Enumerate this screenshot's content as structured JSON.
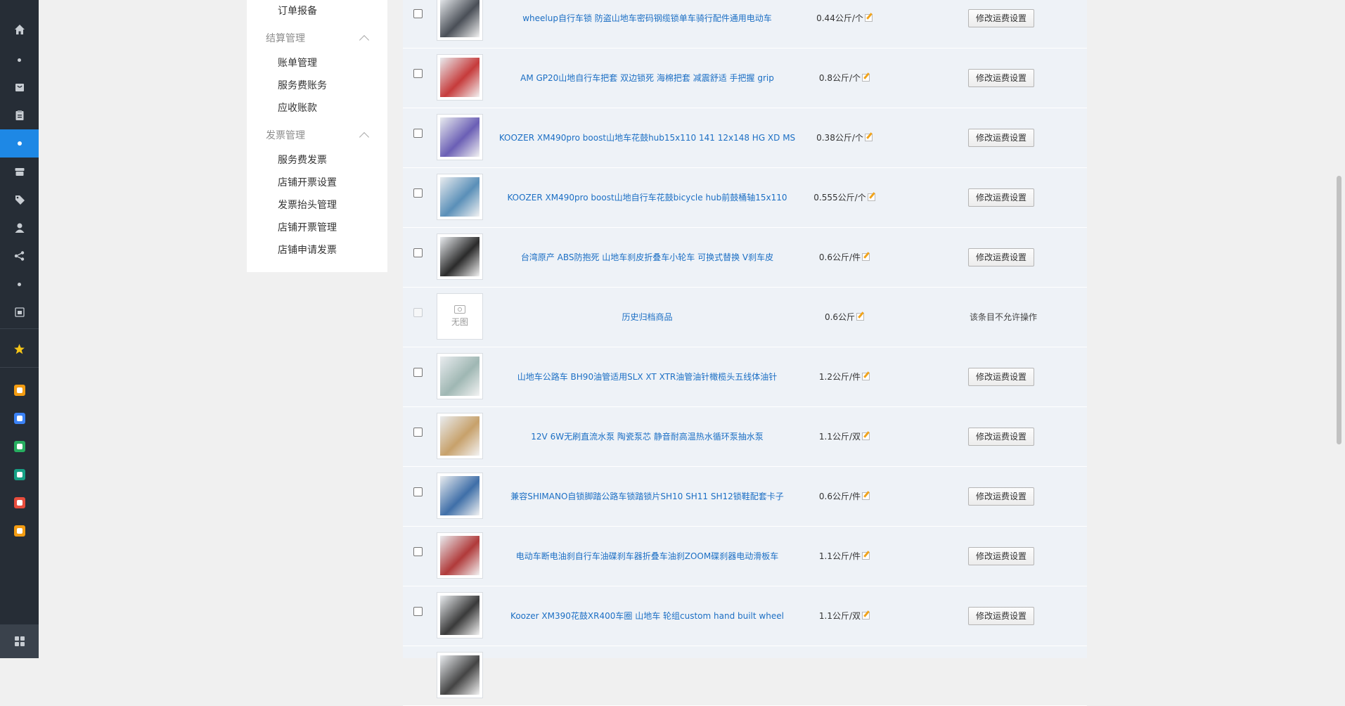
{
  "rail": {
    "items": [
      {
        "icon": "home-icon"
      },
      {
        "icon": "dot-icon"
      },
      {
        "icon": "bag-icon"
      },
      {
        "icon": "clipboard-icon"
      },
      {
        "icon": "dot-icon",
        "active": true
      },
      {
        "icon": "store-icon"
      },
      {
        "icon": "tag-icon"
      },
      {
        "icon": "user-icon"
      },
      {
        "icon": "share-icon"
      },
      {
        "icon": "dot-icon"
      },
      {
        "icon": "box-icon"
      }
    ],
    "apps": [
      {
        "icon": "star-icon",
        "color": "#f5c518"
      },
      {
        "icon": "scale-app-icon",
        "color": "#f39c12"
      },
      {
        "icon": "mail-app-icon",
        "color": "#3b82f6"
      },
      {
        "icon": "shield-app-icon",
        "color": "#27ae60"
      },
      {
        "icon": "person-app-icon",
        "color": "#16a085"
      },
      {
        "icon": "chart-app-icon",
        "color": "#e74c3c"
      },
      {
        "icon": "compass-app-icon",
        "color": "#f39c12"
      }
    ],
    "bottom_icon": "grid-icon"
  },
  "submenu": {
    "top_item": "订单报备",
    "groups": [
      {
        "title": "结算管理",
        "items": [
          "账单管理",
          "服务费账务",
          "应收账款"
        ]
      },
      {
        "title": "发票管理",
        "items": [
          "服务费发票",
          "店铺开票设置",
          "发票抬头管理",
          "店铺开票管理",
          "店铺申请发票"
        ]
      }
    ]
  },
  "button_label": "修改运费设置",
  "no_op_text": "该条目不允许操作",
  "no_image_text": "无图",
  "products": [
    {
      "name": "wheelup自行车锁 防盗山地车密码钢缆锁单车骑行配件通用电动车",
      "weight": "0.44公斤/个",
      "thumb": "#4a4f57"
    },
    {
      "name": "AM GP20山地自行车把套 双边锁死 海棉把套 减震舒适 手把握 grip",
      "weight": "0.8公斤/个",
      "thumb": "#c63b3b"
    },
    {
      "name": "KOOZER XM490pro boost山地车花鼓hub15x110 141 12x148 HG XD MS",
      "weight": "0.38公斤/个",
      "thumb": "#6b5fb5"
    },
    {
      "name": "KOOZER XM490pro boost山地自行车花鼓bicycle hub前鼓桶轴15x110",
      "weight": "0.555公斤/个",
      "thumb": "#5a8fb8"
    },
    {
      "name": "台湾原产 ABS防抱死 山地车刹皮折叠车小轮车 可换式替换 V刹车皮",
      "weight": "0.6公斤/件",
      "thumb": "#2b2b2b"
    },
    {
      "name": "历史归档商品",
      "weight": "0.6公斤",
      "archived": true
    },
    {
      "name": "山地车公路车 BH90油管适用SLX XT XTR油管油针橄榄头五线体油针",
      "weight": "1.2公斤/件",
      "thumb": "#9fb7b3"
    },
    {
      "name": "12V 6W无刷直流水泵 陶瓷泵芯 静音耐高温热水循环泵抽水泵",
      "weight": "1.1公斤/双",
      "thumb": "#c7a16b"
    },
    {
      "name": "兼容SHIMANO自锁脚踏公路车锁踏锁片SH10 SH11 SH12锁鞋配套卡子",
      "weight": "0.6公斤/件",
      "thumb": "#3f6fa8"
    },
    {
      "name": "电动车断电油刹自行车油碟刹车器折叠车油刹ZOOM碟刹器电动滑板车",
      "weight": "1.1公斤/件",
      "thumb": "#b03a3a"
    },
    {
      "name": "Koozer XM390花鼓XR400车圈 山地车 轮组custom hand built wheel",
      "weight": "1.1公斤/双",
      "thumb": "#3a3a3a"
    }
  ]
}
